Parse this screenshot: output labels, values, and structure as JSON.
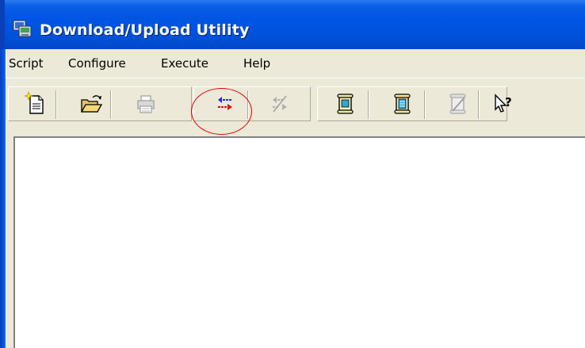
{
  "window": {
    "title": "Download/Upload Utility",
    "accent_color": "#0054e3",
    "highlight_color": "#e00000"
  },
  "menu": {
    "items": [
      "Script",
      "Configure",
      "Execute",
      "Help"
    ]
  },
  "toolbar": {
    "buttons": [
      {
        "icon": "new-document-icon",
        "enabled": true
      },
      {
        "icon": "open-folder-icon",
        "enabled": true
      },
      {
        "icon": "print-icon",
        "enabled": false
      },
      {
        "icon": "transfer-arrows-icon",
        "enabled": true,
        "highlighted": true
      },
      {
        "icon": "transfer-stop-icon",
        "enabled": false
      },
      {
        "icon": "scroll-icon",
        "enabled": true
      },
      {
        "icon": "scroll-list-icon",
        "enabled": true
      },
      {
        "icon": "edit-script-icon",
        "enabled": false
      },
      {
        "icon": "context-help-icon",
        "enabled": true
      }
    ]
  }
}
